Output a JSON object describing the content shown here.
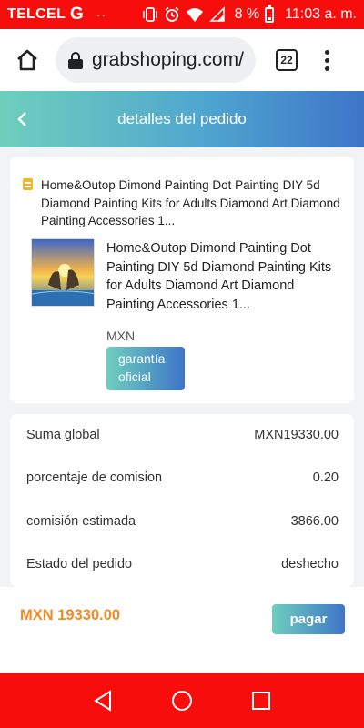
{
  "status_bar": {
    "carrier": "TELCEL",
    "network": "G",
    "dots": "··",
    "battery_percent": "8 %",
    "time": "11:03 a. m.",
    "icons": [
      "vibrate-icon",
      "alarm-icon",
      "wifi-icon",
      "signal-icon",
      "battery-icon"
    ]
  },
  "browser": {
    "url": "grabshoping.com/",
    "tab_count": "22"
  },
  "header": {
    "title": "detalles del pedido"
  },
  "order": {
    "store_name": "Home&Outop Dimond Painting Dot Painting DIY 5d Diamond Painting Kits for Adults Diamond Art Diamond Painting Accessories 1...",
    "product_title": "Home&Outop Dimond Painting Dot Painting DIY 5d Diamond Painting Kits for Adults Diamond Art Diamond Painting Accessories 1...",
    "product_price": "MXN",
    "badge": "garantía oficial"
  },
  "summary": {
    "rows": [
      {
        "label": "Suma global",
        "value": "MXN19330.00"
      },
      {
        "label": "porcentaje de comision",
        "value": "0.20"
      },
      {
        "label": "comisión estimada",
        "value": "3866.00"
      },
      {
        "label": "Estado del pedido",
        "value": "deshecho"
      }
    ]
  },
  "footer": {
    "total": "MXN 19330.00",
    "pay_label": "pagar"
  },
  "colors": {
    "status_red": "#f80d0d",
    "gradient_start": "#6ecfbd",
    "gradient_end": "#3e75c9",
    "total_orange": "#f08a24"
  }
}
